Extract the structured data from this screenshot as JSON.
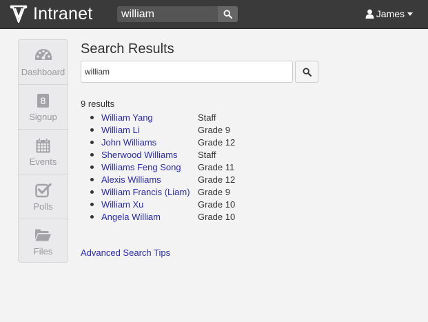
{
  "navbar": {
    "brand": "Intranet",
    "search_value": "william",
    "user_name": "James"
  },
  "sidebar": {
    "items": [
      {
        "label": "Dashboard",
        "icon": "dashboard-icon"
      },
      {
        "label": "Signup",
        "icon": "signup-badge",
        "badge": "8"
      },
      {
        "label": "Events",
        "icon": "calendar-icon"
      },
      {
        "label": "Polls",
        "icon": "checkbox-icon"
      },
      {
        "label": "Files",
        "icon": "folder-icon"
      }
    ]
  },
  "main": {
    "title": "Search Results",
    "search_value": "william",
    "result_count": "9 results",
    "results": [
      {
        "name": "William Yang",
        "grade": "Staff"
      },
      {
        "name": "William Li",
        "grade": "Grade 9"
      },
      {
        "name": "John Williams",
        "grade": "Grade 12"
      },
      {
        "name": "Sherwood Williams",
        "grade": "Staff"
      },
      {
        "name": "Williams Feng Song",
        "grade": "Grade 11"
      },
      {
        "name": "Alexis Williams",
        "grade": "Grade 12"
      },
      {
        "name": "William Francis (Liam)",
        "grade": "Grade 9"
      },
      {
        "name": "William Xu",
        "grade": "Grade 10"
      },
      {
        "name": "Angela William",
        "grade": "Grade 10"
      }
    ],
    "tips_link": "Advanced Search Tips"
  },
  "colors": {
    "navbar_bg": "#3a3a3a",
    "link": "#2a2ab5",
    "page_bg": "#f3f3f4",
    "sidebar_icon": "#a4a4a8"
  }
}
